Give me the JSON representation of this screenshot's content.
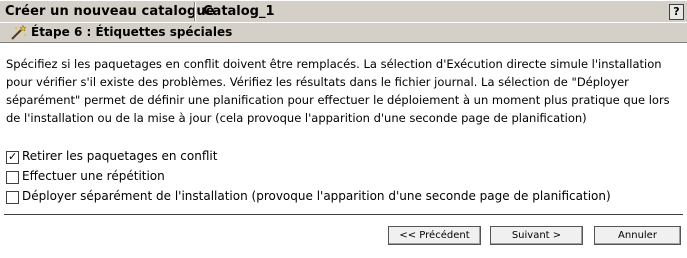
{
  "header": {
    "title": "Créer un nouveau catalogue",
    "catalog_name": "Catalog_1",
    "help_label": "?"
  },
  "step": {
    "icon": "wand-icon",
    "title": "Étape 6 : Étiquettes spéciales"
  },
  "description": "Spécifiez si les paquetages en conflit doivent être remplacés. La sélection d'Exécution directe simule l'installation pour vérifier s'il existe des problèmes. Vérifiez les résultats dans le fichier journal. La sélection de \"Déployer séparément\" permet de définir une planification pour effectuer le déploiement à un moment plus pratique que lors de l'installation ou de la mise à jour (cela provoque l'apparition d'une seconde page de planification)",
  "options": [
    {
      "label": "Retirer les paquetages en conflit",
      "checked": true,
      "mark": "✓"
    },
    {
      "label": "Effectuer une répétition",
      "checked": false
    },
    {
      "label": "Déployer séparément de l'installation (provoque l'apparition d'une seconde page de planification)",
      "checked": false
    }
  ],
  "buttons": {
    "previous": "<< Précédent",
    "next": "Suivant >",
    "cancel": "Annuler"
  }
}
